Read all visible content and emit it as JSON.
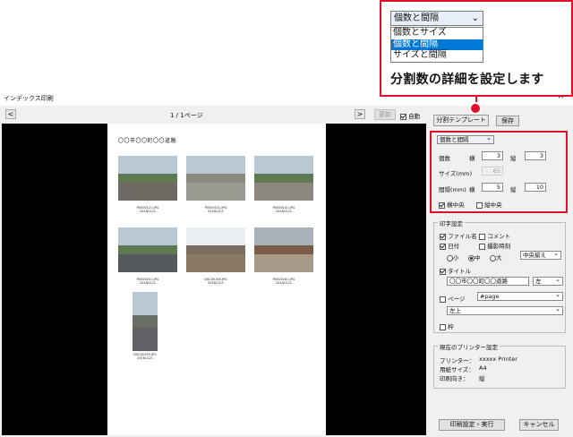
{
  "window": {
    "title": "インデックス印刷",
    "close": "✕"
  },
  "toolbar": {
    "prev": "<",
    "next": ">",
    "page_indicator": "1 / 1ページ",
    "update": "更新",
    "auto": "自動"
  },
  "preview": {
    "doc_title": "〇〇市〇〇町〇〇道路",
    "captions": [
      "P0000121.JPG\n2016/12/1",
      "P0000131.JPG\n2016/12/1",
      "P0000141.JPG\n2016/12/1",
      "P0000151.JPG\n2016/12/1",
      "DSC00158.JPG\n2016/12/1",
      "P0000161.JPG\n2016/12/1",
      "DSC00159.JPG\n2016/12/1"
    ]
  },
  "template": {
    "button": "分割テンプレート",
    "save": "保存"
  },
  "division": {
    "mode": "個数と間隔",
    "count_label": "個数",
    "yoko": "横",
    "tate": "縦",
    "count_h": "3",
    "count_v": "3",
    "size_label": "サイズ(mm)",
    "size_value": "65",
    "gap_label": "間隔(mm)",
    "gap_h": "5",
    "gap_v": "10",
    "center_h": "横中央",
    "center_v": "縦中央"
  },
  "print_settings": {
    "legend": "印字設定",
    "filename": "ファイル名",
    "comment": "コメント",
    "date": "日付",
    "photo_time": "撮影時刻",
    "small": "小",
    "medium": "中",
    "large": "大",
    "align": "中央揃え",
    "title": "タイトル",
    "title_value": "〇〇市〇〇町〇〇道路",
    "title_align": "左",
    "page": "ページ",
    "page_format": "#page",
    "page_pos": "左上",
    "frame": "枠"
  },
  "printer": {
    "legend": "現在のプリンター設定",
    "printer_label": "プリンター：",
    "printer_value": "xxxxx Printer",
    "paper_label": "用紙サイズ：",
    "paper_value": "A4",
    "orient_label": "印刷向き：",
    "orient_value": "縦"
  },
  "footer": {
    "print": "印刷設定・実行",
    "cancel": "キャンセル"
  },
  "callout": {
    "dropdown_value": "個数と間隔",
    "options": [
      "個数とサイズ",
      "個数と間隔",
      "サイズと間隔"
    ],
    "message": "分割数の詳細を設定します"
  },
  "colors": {
    "highlight": "#e0102a",
    "selection": "#0078d7"
  }
}
